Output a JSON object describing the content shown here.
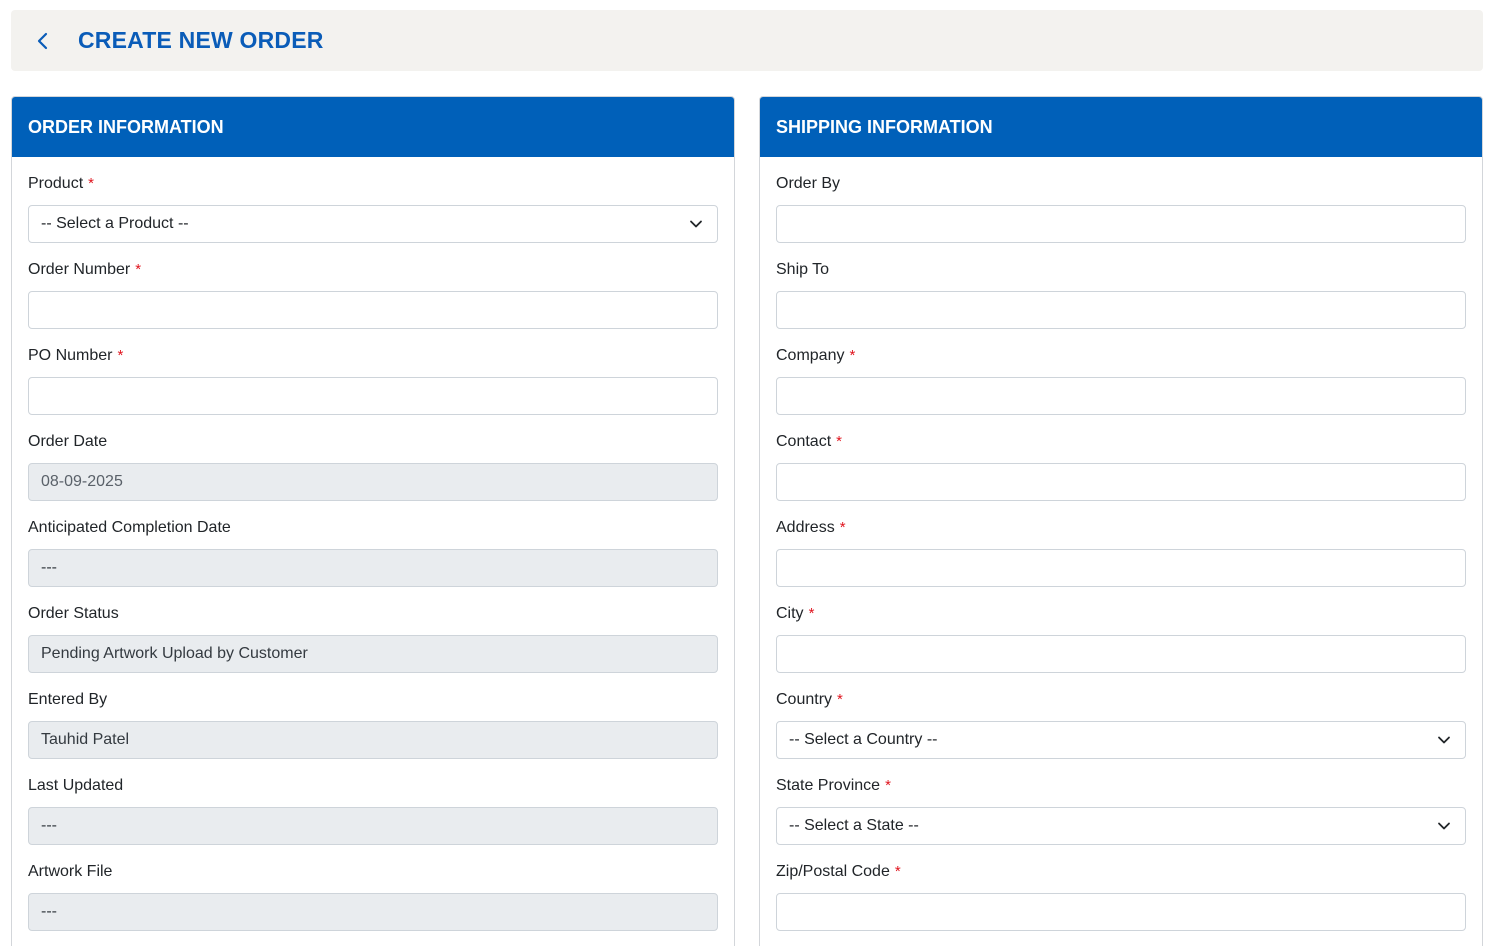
{
  "header": {
    "title": "CREATE NEW ORDER"
  },
  "order_info": {
    "title": "ORDER INFORMATION",
    "fields": [
      {
        "label": "Product",
        "required": true,
        "type": "select",
        "value": "-- Select a Product --"
      },
      {
        "label": "Order Number",
        "required": true,
        "type": "input",
        "value": ""
      },
      {
        "label": "PO Number",
        "required": true,
        "type": "input",
        "value": ""
      },
      {
        "label": "Order Date",
        "required": false,
        "type": "readonly",
        "value": "08-09-2025"
      },
      {
        "label": "Anticipated Completion Date",
        "required": false,
        "type": "readonly",
        "value": "---"
      },
      {
        "label": "Order Status",
        "required": false,
        "type": "readonly",
        "value": "Pending Artwork Upload by Customer"
      },
      {
        "label": "Entered By",
        "required": false,
        "type": "readonly",
        "value": "Tauhid Patel"
      },
      {
        "label": "Last Updated",
        "required": false,
        "type": "readonly",
        "value": "---"
      },
      {
        "label": "Artwork File",
        "required": false,
        "type": "readonly",
        "value": "---"
      }
    ]
  },
  "shipping_info": {
    "title": "SHIPPING INFORMATION",
    "fields": [
      {
        "label": "Order By",
        "required": false,
        "type": "input",
        "value": ""
      },
      {
        "label": "Ship To",
        "required": false,
        "type": "input",
        "value": ""
      },
      {
        "label": "Company",
        "required": true,
        "type": "input",
        "value": ""
      },
      {
        "label": "Contact",
        "required": true,
        "type": "input",
        "value": ""
      },
      {
        "label": "Address",
        "required": true,
        "type": "input",
        "value": ""
      },
      {
        "label": "City",
        "required": true,
        "type": "input",
        "value": ""
      },
      {
        "label": "Country",
        "required": true,
        "type": "select",
        "value": "-- Select a Country --"
      },
      {
        "label": "State Province",
        "required": true,
        "type": "select",
        "value": "-- Select a State --"
      },
      {
        "label": "Zip/Postal Code",
        "required": true,
        "type": "input",
        "value": ""
      }
    ]
  },
  "required_marker": "*",
  "colors": {
    "accent": "#0a5cb8",
    "card_header": "#0060b9",
    "required": "#e0141e",
    "readonly_bg": "#e9ecef",
    "header_bg": "#f3f2ef"
  },
  "icons": {
    "back": "chevron-left-icon",
    "dropdown": "chevron-down-icon"
  }
}
